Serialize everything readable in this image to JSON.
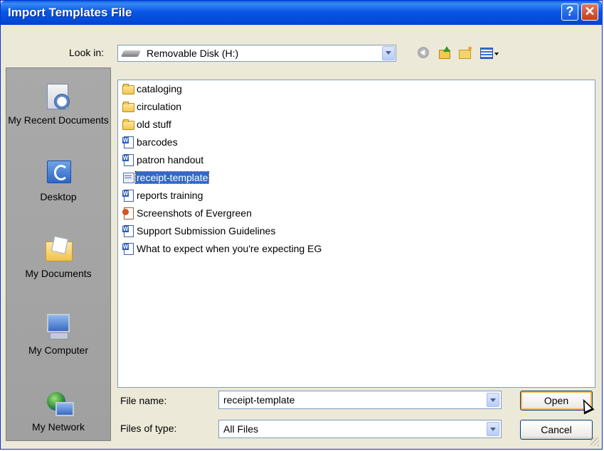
{
  "window": {
    "title": "Import Templates File",
    "help_glyph": "?",
    "close_glyph": "✕"
  },
  "toolbar": {
    "look_in_label": "Look in:",
    "look_in_value": "Removable Disk (H:)",
    "icons": [
      "drive-icon",
      "back-icon",
      "up-folder-icon",
      "new-folder-icon",
      "views-menu-icon"
    ]
  },
  "places": [
    {
      "label": "My Recent Documents",
      "icon": "recent-documents-icon"
    },
    {
      "label": "Desktop",
      "icon": "desktop-icon"
    },
    {
      "label": "My Documents",
      "icon": "my-documents-icon"
    },
    {
      "label": "My Computer",
      "icon": "my-computer-icon"
    },
    {
      "label": "My Network",
      "icon": "my-network-icon"
    }
  ],
  "files": [
    {
      "name": "cataloging",
      "type": "folder"
    },
    {
      "name": "circulation",
      "type": "folder"
    },
    {
      "name": "old stuff",
      "type": "folder"
    },
    {
      "name": "barcodes",
      "type": "word"
    },
    {
      "name": "patron handout",
      "type": "word"
    },
    {
      "name": "receipt-template",
      "type": "template",
      "selected": true
    },
    {
      "name": "reports training",
      "type": "word"
    },
    {
      "name": "Screenshots of Evergreen",
      "type": "powerpoint"
    },
    {
      "name": "Support Submission Guidelines",
      "type": "word"
    },
    {
      "name": "What to expect when you're expecting EG",
      "type": "word"
    }
  ],
  "footer": {
    "file_name_label": "File name:",
    "file_name_value": "receipt-template",
    "file_type_label": "Files of type:",
    "file_type_value": "All Files",
    "open_label": "Open",
    "cancel_label": "Cancel"
  },
  "colors": {
    "titlebar": "#0858e6",
    "selection": "#316ac5",
    "dialog_bg": "#ece9d8",
    "places_bg": "#a5a5a5"
  }
}
